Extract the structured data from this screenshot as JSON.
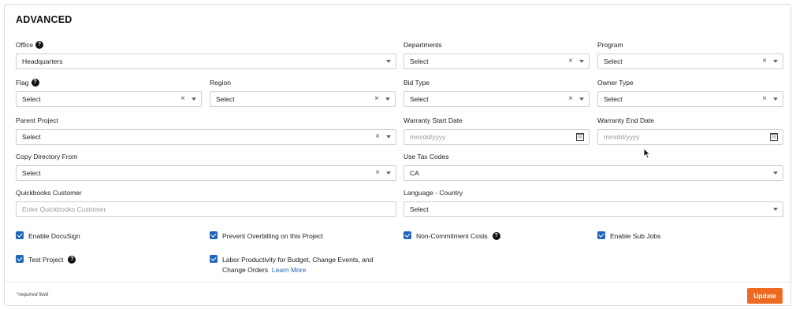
{
  "section": {
    "title": "ADVANCED"
  },
  "fields": {
    "office": {
      "label": "Office",
      "value": "Headquarters"
    },
    "departments": {
      "label": "Departments",
      "value": "Select"
    },
    "program": {
      "label": "Program",
      "value": "Select"
    },
    "flag": {
      "label": "Flag",
      "value": "Select"
    },
    "region": {
      "label": "Region",
      "value": "Select"
    },
    "bid_type": {
      "label": "Bid Type",
      "value": "Select"
    },
    "owner_type": {
      "label": "Owner Type",
      "value": "Select"
    },
    "parent_project": {
      "label": "Parent Project",
      "value": "Select"
    },
    "warranty_start": {
      "label": "Warranty Start Date",
      "placeholder": "mm/dd/yyyy"
    },
    "warranty_end": {
      "label": "Warranty End Date",
      "placeholder": "mm/dd/yyyy"
    },
    "copy_directory": {
      "label": "Copy Directory From",
      "value": "Select"
    },
    "use_tax_codes": {
      "label": "Use Tax Codes",
      "value": "CA"
    },
    "quickbooks_customer": {
      "label": "Quickbooks Customer",
      "placeholder": "Enter Quickbooks Customer"
    },
    "language_country": {
      "label": "Language - Country",
      "value": "Select"
    }
  },
  "checkboxes": {
    "enable_docusign": {
      "label": "Enable DocuSign",
      "checked": true
    },
    "prevent_overbilling": {
      "label": "Prevent Overbilling on this Project",
      "checked": true
    },
    "non_commitment_costs": {
      "label": "Non-Commitment Costs",
      "checked": true
    },
    "enable_sub_jobs": {
      "label": "Enable Sub Jobs",
      "checked": true
    },
    "test_project": {
      "label": "Test Project",
      "checked": true
    },
    "labor_productivity": {
      "label": "Labor Productivity for Budget, Change Events, and Change Orders",
      "link": "Learn More",
      "checked": true
    }
  },
  "footer": {
    "required_note": "*required field",
    "update_label": "Update"
  },
  "icons": {
    "help": "?",
    "clear": "×"
  },
  "colors": {
    "accent": "#ee6a22",
    "checkbox": "#2066b8",
    "link": "#2066b8"
  }
}
